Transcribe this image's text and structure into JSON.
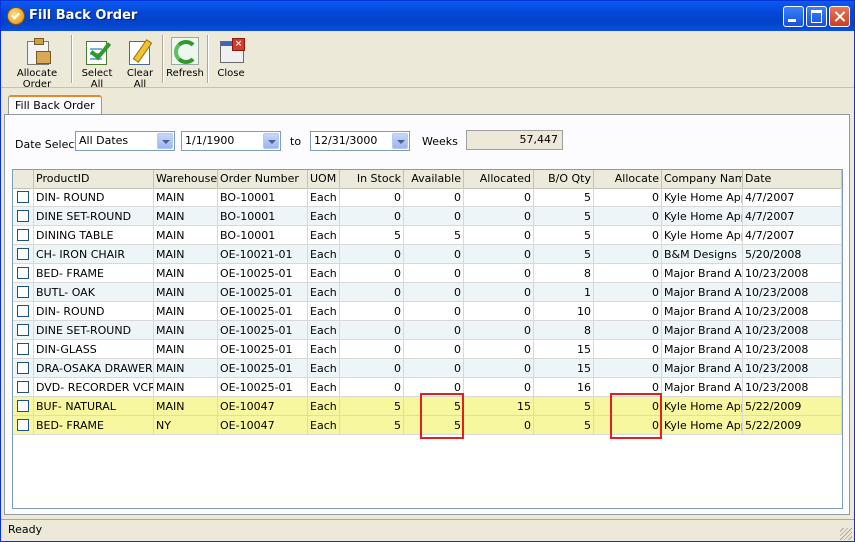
{
  "window": {
    "title": "Fill Back Order"
  },
  "toolbar": {
    "allocate_order": "Allocate Order",
    "select_all": "Select All",
    "clear_all": "Clear All",
    "refresh": "Refresh",
    "close": "Close"
  },
  "tab": {
    "label": "Fill Back Order"
  },
  "filters": {
    "date_select_label": "Date Select",
    "date_option": "All Dates",
    "from_date": "1/1/1900",
    "to_label": "to",
    "to_date": "12/31/3000",
    "weeks_label": "Weeks",
    "weeks_value": "57,447"
  },
  "grid": {
    "columns": [
      "ProductID",
      "Warehouse ID",
      "Order Number",
      "UOM",
      "In Stock",
      "Available",
      "Allocated",
      "B/O Qty",
      "Allocate",
      "Company Name",
      "Date"
    ],
    "rows": [
      [
        "DIN- ROUND",
        "MAIN",
        "BO-10001",
        "Each",
        "0",
        "0",
        "0",
        "5",
        "0",
        "Kyle Home Appli",
        "4/7/2007"
      ],
      [
        "DINE SET-ROUND",
        "MAIN",
        "BO-10001",
        "Each",
        "0",
        "0",
        "0",
        "5",
        "0",
        "Kyle Home Appli",
        "4/7/2007"
      ],
      [
        "DINING TABLE",
        "MAIN",
        "BO-10001",
        "Each",
        "5",
        "5",
        "0",
        "5",
        "0",
        "Kyle Home Appli",
        "4/7/2007"
      ],
      [
        "CH- IRON CHAIR",
        "MAIN",
        "OE-10021-01",
        "Each",
        "0",
        "0",
        "0",
        "5",
        "0",
        "B&M Designs",
        "5/20/2008"
      ],
      [
        "BED- FRAME",
        "MAIN",
        "OE-10025-01",
        "Each",
        "0",
        "0",
        "0",
        "8",
        "0",
        "Major Brand App",
        "10/23/2008"
      ],
      [
        "BUTL- OAK",
        "MAIN",
        "OE-10025-01",
        "Each",
        "0",
        "0",
        "0",
        "1",
        "0",
        "Major Brand App",
        "10/23/2008"
      ],
      [
        "DIN- ROUND",
        "MAIN",
        "OE-10025-01",
        "Each",
        "0",
        "0",
        "0",
        "10",
        "0",
        "Major Brand App",
        "10/23/2008"
      ],
      [
        "DINE SET-ROUND",
        "MAIN",
        "OE-10025-01",
        "Each",
        "0",
        "0",
        "0",
        "8",
        "0",
        "Major Brand App",
        "10/23/2008"
      ],
      [
        "DIN-GLASS",
        "MAIN",
        "OE-10025-01",
        "Each",
        "0",
        "0",
        "0",
        "15",
        "0",
        "Major Brand App",
        "10/23/2008"
      ],
      [
        "DRA-OSAKA DRAWER",
        "MAIN",
        "OE-10025-01",
        "Each",
        "0",
        "0",
        "0",
        "15",
        "0",
        "Major Brand App",
        "10/23/2008"
      ],
      [
        "DVD- RECORDER VCR",
        "MAIN",
        "OE-10025-01",
        "Each",
        "0",
        "0",
        "0",
        "16",
        "0",
        "Major Brand App",
        "10/23/2008"
      ],
      [
        "BUF- NATURAL",
        "MAIN",
        "OE-10047",
        "Each",
        "5",
        "5",
        "15",
        "5",
        "0",
        "Kyle Home Appli",
        "5/22/2009"
      ],
      [
        "BED- FRAME",
        "NY",
        "OE-10047",
        "Each",
        "5",
        "5",
        "0",
        "5",
        "0",
        "Kyle Home Appli",
        "5/22/2009"
      ]
    ],
    "highlighted_rows": [
      11,
      12
    ],
    "highlight_color": "#f7f7a0",
    "annotation_color": "#e02020"
  },
  "status": {
    "text": "Ready"
  }
}
